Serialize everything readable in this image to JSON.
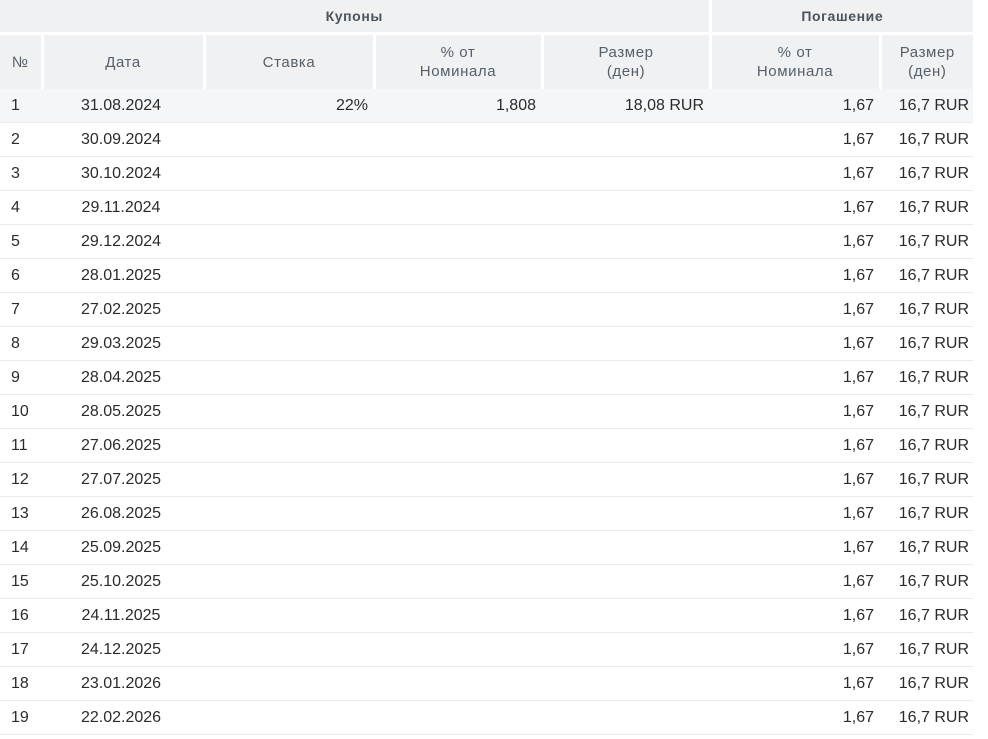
{
  "table": {
    "group_headers": {
      "coupons": "Купоны",
      "redemption": "Погашение"
    },
    "columns": {
      "number": "№",
      "date": "Дата",
      "rate": "Ставка",
      "coupon_pct_line1": "% от",
      "coupon_pct_line2": "Номинала",
      "coupon_size_line1": "Размер",
      "coupon_size_line2": "(ден)",
      "redeem_pct_line1": "% от",
      "redeem_pct_line2": "Номинала",
      "redeem_size_line1": "Размер",
      "redeem_size_line2": "(ден)"
    },
    "rows": [
      {
        "no": "1",
        "date": "31.08.2024",
        "rate": "22%",
        "coupon_pct": "1,808",
        "coupon_size": "18,08 RUR",
        "redeem_pct": "1,67",
        "redeem_size": "16,7 RUR"
      },
      {
        "no": "2",
        "date": "30.09.2024",
        "rate": "",
        "coupon_pct": "",
        "coupon_size": "",
        "redeem_pct": "1,67",
        "redeem_size": "16,7 RUR"
      },
      {
        "no": "3",
        "date": "30.10.2024",
        "rate": "",
        "coupon_pct": "",
        "coupon_size": "",
        "redeem_pct": "1,67",
        "redeem_size": "16,7 RUR"
      },
      {
        "no": "4",
        "date": "29.11.2024",
        "rate": "",
        "coupon_pct": "",
        "coupon_size": "",
        "redeem_pct": "1,67",
        "redeem_size": "16,7 RUR"
      },
      {
        "no": "5",
        "date": "29.12.2024",
        "rate": "",
        "coupon_pct": "",
        "coupon_size": "",
        "redeem_pct": "1,67",
        "redeem_size": "16,7 RUR"
      },
      {
        "no": "6",
        "date": "28.01.2025",
        "rate": "",
        "coupon_pct": "",
        "coupon_size": "",
        "redeem_pct": "1,67",
        "redeem_size": "16,7 RUR"
      },
      {
        "no": "7",
        "date": "27.02.2025",
        "rate": "",
        "coupon_pct": "",
        "coupon_size": "",
        "redeem_pct": "1,67",
        "redeem_size": "16,7 RUR"
      },
      {
        "no": "8",
        "date": "29.03.2025",
        "rate": "",
        "coupon_pct": "",
        "coupon_size": "",
        "redeem_pct": "1,67",
        "redeem_size": "16,7 RUR"
      },
      {
        "no": "9",
        "date": "28.04.2025",
        "rate": "",
        "coupon_pct": "",
        "coupon_size": "",
        "redeem_pct": "1,67",
        "redeem_size": "16,7 RUR"
      },
      {
        "no": "10",
        "date": "28.05.2025",
        "rate": "",
        "coupon_pct": "",
        "coupon_size": "",
        "redeem_pct": "1,67",
        "redeem_size": "16,7 RUR"
      },
      {
        "no": "11",
        "date": "27.06.2025",
        "rate": "",
        "coupon_pct": "",
        "coupon_size": "",
        "redeem_pct": "1,67",
        "redeem_size": "16,7 RUR"
      },
      {
        "no": "12",
        "date": "27.07.2025",
        "rate": "",
        "coupon_pct": "",
        "coupon_size": "",
        "redeem_pct": "1,67",
        "redeem_size": "16,7 RUR"
      },
      {
        "no": "13",
        "date": "26.08.2025",
        "rate": "",
        "coupon_pct": "",
        "coupon_size": "",
        "redeem_pct": "1,67",
        "redeem_size": "16,7 RUR"
      },
      {
        "no": "14",
        "date": "25.09.2025",
        "rate": "",
        "coupon_pct": "",
        "coupon_size": "",
        "redeem_pct": "1,67",
        "redeem_size": "16,7 RUR"
      },
      {
        "no": "15",
        "date": "25.10.2025",
        "rate": "",
        "coupon_pct": "",
        "coupon_size": "",
        "redeem_pct": "1,67",
        "redeem_size": "16,7 RUR"
      },
      {
        "no": "16",
        "date": "24.11.2025",
        "rate": "",
        "coupon_pct": "",
        "coupon_size": "",
        "redeem_pct": "1,67",
        "redeem_size": "16,7 RUR"
      },
      {
        "no": "17",
        "date": "24.12.2025",
        "rate": "",
        "coupon_pct": "",
        "coupon_size": "",
        "redeem_pct": "1,67",
        "redeem_size": "16,7 RUR"
      },
      {
        "no": "18",
        "date": "23.01.2026",
        "rate": "",
        "coupon_pct": "",
        "coupon_size": "",
        "redeem_pct": "1,67",
        "redeem_size": "16,7 RUR"
      },
      {
        "no": "19",
        "date": "22.02.2026",
        "rate": "",
        "coupon_pct": "",
        "coupon_size": "",
        "redeem_pct": "1,67",
        "redeem_size": "16,7 RUR"
      }
    ]
  }
}
